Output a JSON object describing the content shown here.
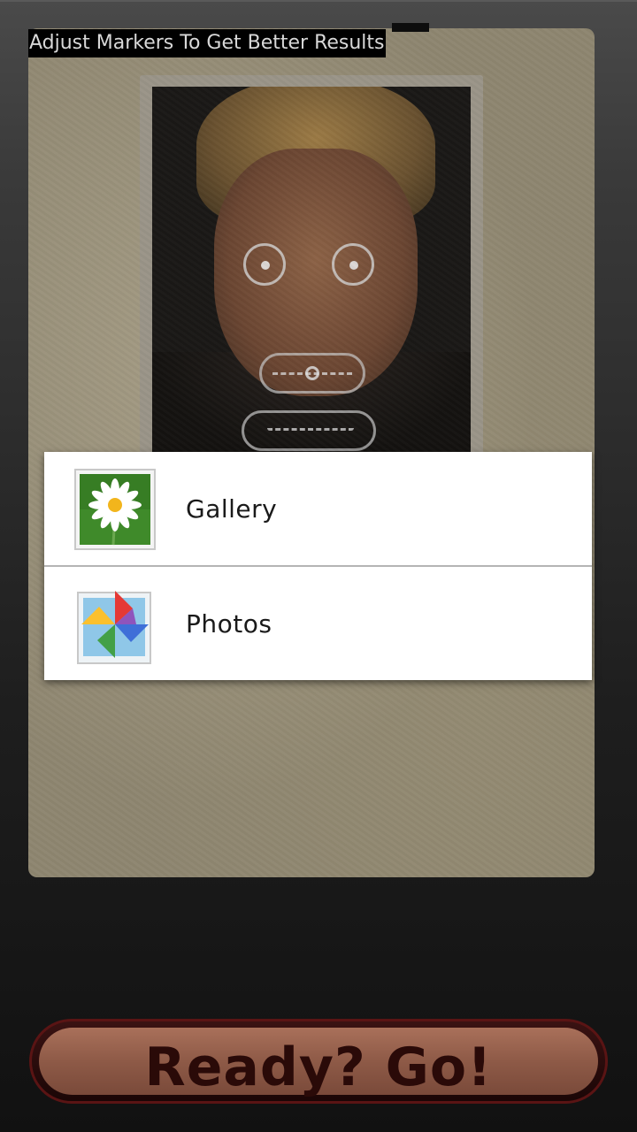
{
  "hint_text": "Adjust Markers To Get Better Results",
  "chooser": {
    "items": [
      {
        "label": "Gallery",
        "icon": "gallery-daisy-icon"
      },
      {
        "label": "Photos",
        "icon": "photos-pinwheel-icon"
      }
    ]
  },
  "go_button": {
    "label": "Ready? Go!"
  },
  "colors": {
    "button_fill": "#8e5a47",
    "button_text": "#2a0a08",
    "chooser_bg": "#ffffff"
  }
}
